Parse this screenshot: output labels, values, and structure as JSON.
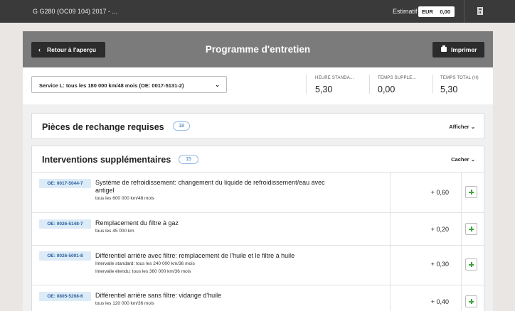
{
  "topbar": {
    "vehicle": "G G280 (OC09 104) 2017 - ...",
    "estimate_label": "Estimatif",
    "currency": "EUR",
    "amount": "0,00",
    "calculator_icon": "calculator-icon"
  },
  "header": {
    "back_label": "Retour à l'aperçu",
    "title": "Programme d'entretien",
    "print_label": "Imprimer",
    "print_icon": "printer-icon"
  },
  "service": {
    "selected": "Service L: tous les 180 000 km/48 mois (OE: 0017-5131-2)"
  },
  "stats": [
    {
      "label": "HEURE STANDA...",
      "value": "5,30"
    },
    {
      "label": "TEMPS SUPPLE...",
      "value": "0,00"
    },
    {
      "label": "TEMPS TOTAL (H)",
      "value": "5,30"
    }
  ],
  "parts_panel": {
    "title": "Pièces de rechange requises",
    "count": "18",
    "toggle": "Afficher"
  },
  "interventions_panel": {
    "title": "Interventions supplémentaires",
    "count": "15",
    "toggle": "Cacher",
    "rows": [
      {
        "oe": "OE: 0017-5044-7",
        "desc": "Système de refroidissement: changement du liquide de refroidissement/eau avec antigel",
        "sub1": "tous les 600 000 km/48 mois",
        "sub2": "",
        "time": "+ 0,60"
      },
      {
        "oe": "OE: 0026-5148-7",
        "desc": "Remplacement du filtre à gaz",
        "sub1": "tous les 45 000 km",
        "sub2": "",
        "time": "+ 0,20"
      },
      {
        "oe": "OE: 0026-5001-8",
        "desc": "Différentiel arrière avec filtre: remplacement de l'huile et le filtre à huile",
        "sub1": "Intervalle standard: tous les 240 000 km/36 mois",
        "sub2": "Intervalle étendu: tous les 360 000 km/36 mois",
        "time": "+ 0,30"
      },
      {
        "oe": "OE: 0805-5208-6",
        "desc": "Différentiel arrière sans filtre: vidange d'huile",
        "sub1": "tous les 120 000 km/36 mois",
        "sub2": "",
        "time": "+ 0,40"
      }
    ]
  },
  "colors": {
    "topbar": "#3a3a3a",
    "header": "#7b7b7b",
    "button_dark": "#2c2c2c",
    "badge_bg": "#dcebf8",
    "badge_text": "#2a5f99",
    "add_green": "#3da33d"
  }
}
